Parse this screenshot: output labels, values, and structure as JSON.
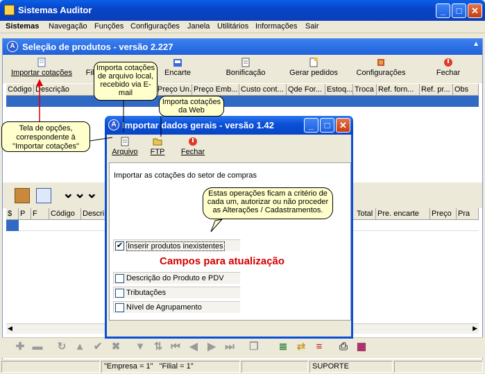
{
  "app": {
    "title": "Sistemas Auditor"
  },
  "menu": [
    "Sistemas",
    "Navegação",
    "Funções",
    "Configurações",
    "Janela",
    "Utilitários",
    "Informações",
    "Sair"
  ],
  "child": {
    "title": "Seleção de produtos - versão 2.227",
    "toolbar": {
      "import": "Importar cotações",
      "filter": "Filt",
      "encarte": "Encarte",
      "bonificacao": "Bonificação",
      "gerar": "Gerar pedidos",
      "config": "Configurações",
      "fechar": "Fechar"
    },
    "columns": [
      "Código",
      "Descrição",
      "Preço Un.",
      "Preço Emb...",
      "Custo cont...",
      "Qde For...",
      "Estoq...",
      "Troca",
      "Ref. forn...",
      "Ref. pr...",
      "Obs"
    ],
    "lower_columns": [
      "$",
      "P",
      "F",
      "Código",
      "Descri",
      "Total",
      "Pre. encarte",
      "Preço",
      "Pra"
    ]
  },
  "dialog": {
    "title": "Importar dados gerais - versão 1.42",
    "toolbar": {
      "arquivo": "Arquivo",
      "ftp": "FTP",
      "fechar": "Fechar"
    },
    "section_label": "Importar as cotações do setor de compras",
    "field_update_title": "Campos para atualização",
    "checkboxes": [
      {
        "label": "Inserir produtos inexistentes",
        "checked": true
      },
      {
        "label": "Descrição do Produto e PDV",
        "checked": false
      },
      {
        "label": "Tributações",
        "checked": false
      },
      {
        "label": "Nível de Agrupamento",
        "checked": false
      }
    ]
  },
  "callouts": {
    "local": "Importa cotações de arquivo local, recebido via E-mail",
    "web": "Importa cotações da Web",
    "options": "Tela de opções, correspondente à \"Importar cotações\"",
    "operations": "Estas operações ficam a critério de cada um, autorizar ou não proceder as Alterações / Cadastramentos."
  },
  "status": {
    "empresa": "\"Empresa = 1\"",
    "filial": "\"Filial = 1\"",
    "user": "SUPORTE"
  },
  "colors": {
    "accent": "#0a4fd8",
    "selection": "#316ac5",
    "red_title": "#d40000",
    "callout_bg": "#ffffcc"
  }
}
